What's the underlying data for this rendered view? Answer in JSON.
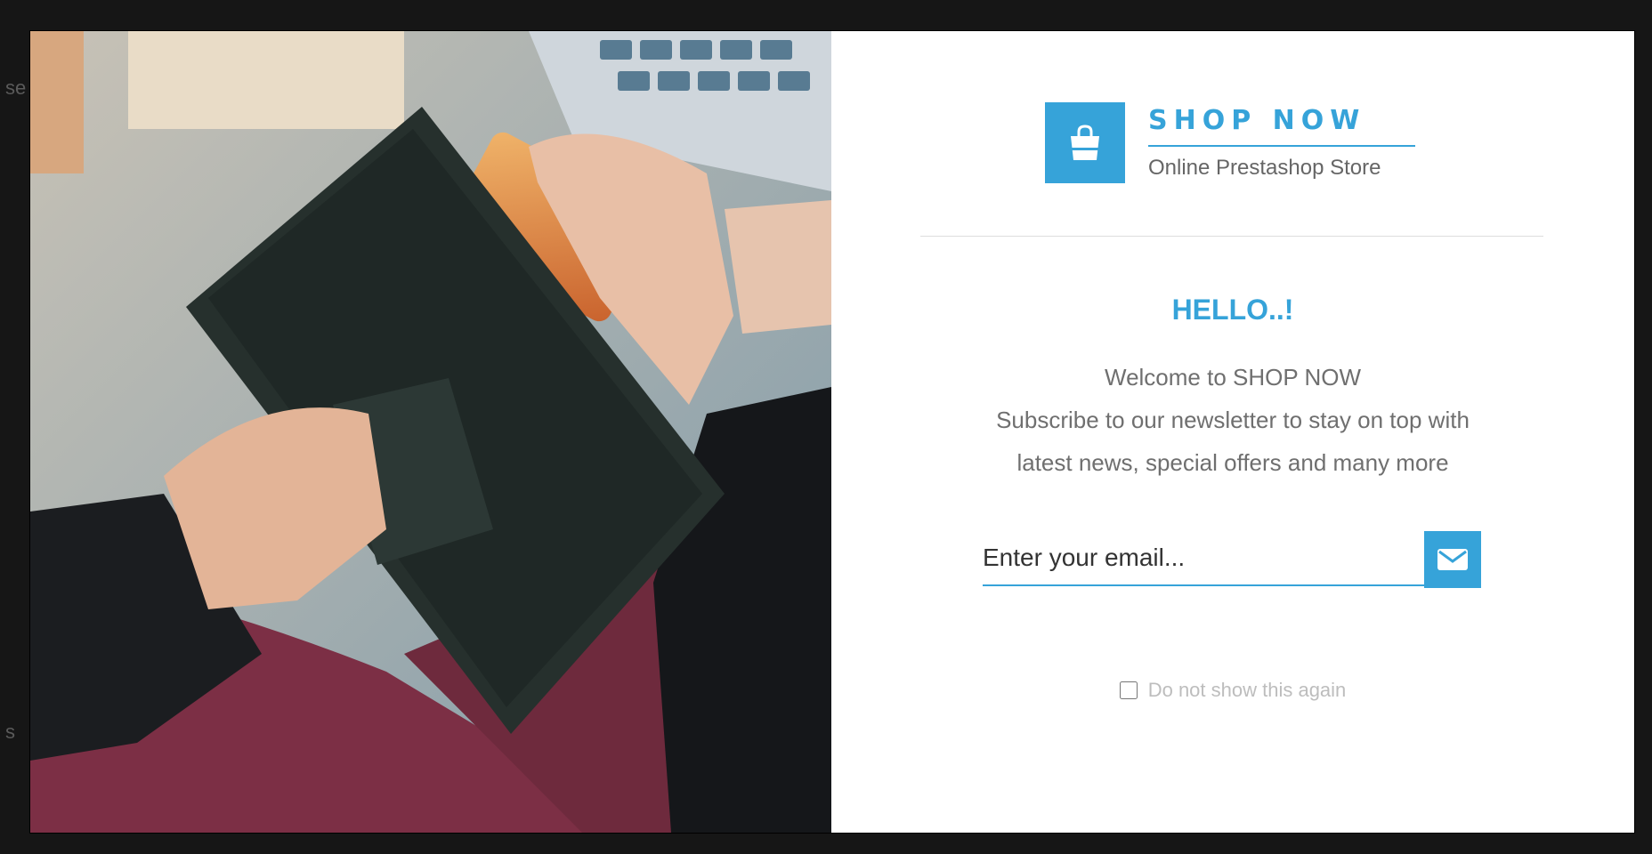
{
  "background": {
    "edge_letters": [
      "se",
      "s"
    ]
  },
  "brand": {
    "icon": "shopping-bag-icon",
    "title": "SHOP NOW",
    "subtitle": "Online Prestashop Store"
  },
  "popup": {
    "heading": "HELLO..!",
    "lines": [
      "Welcome to SHOP NOW",
      "Subscribe to our newsletter to stay on top with",
      "latest news, special offers and many more"
    ],
    "email_placeholder": "Enter your email...",
    "submit_icon": "envelope-icon",
    "dont_show_label": "Do not show this again"
  },
  "colors": {
    "accent": "#36a3d9"
  }
}
